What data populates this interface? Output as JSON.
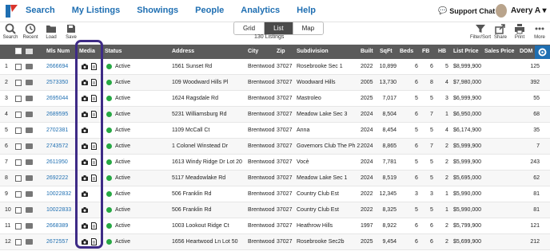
{
  "nav": {
    "links": [
      "Search",
      "My Listings",
      "Showings",
      "People",
      "Analytics",
      "Help"
    ],
    "support": "Support Chat",
    "user": "Avery A"
  },
  "toolbar": {
    "left": [
      "Search",
      "Recent",
      "Load",
      "Save"
    ],
    "views": [
      "Grid",
      "List",
      "Map"
    ],
    "active_view": "List",
    "count": "130 Listings",
    "right": [
      "Filter/Sort",
      "Share",
      "Print",
      "More"
    ]
  },
  "colors": {
    "link": "#1f6fb2",
    "header": "#5b5b5b",
    "active": "#27a844",
    "highlight": "#3e2b86"
  },
  "columns": [
    "Mls Num",
    "Media",
    "Status",
    "Address",
    "City",
    "Zip",
    "Subdivision",
    "Built",
    "SqFt",
    "Beds",
    "FB",
    "HB",
    "List Price",
    "Sales Price",
    "DOM"
  ],
  "rows": [
    {
      "n": "1",
      "mls": "2666694",
      "doc": true,
      "status": "Active",
      "address": "1561 Sunset Rd",
      "city": "Brentwood",
      "zip": "37027",
      "sub": "Rosebrooke Sec 1",
      "built": "2022",
      "sqft": "10,899",
      "beds": "6",
      "fb": "6",
      "hb": "5",
      "price": "$8,999,900",
      "dom": "125"
    },
    {
      "n": "2",
      "mls": "2573350",
      "doc": true,
      "status": "Active",
      "address": "109 Woodward Hills Pl",
      "city": "Brentwood",
      "zip": "37027",
      "sub": "Woodward Hills",
      "built": "2005",
      "sqft": "13,730",
      "beds": "6",
      "fb": "8",
      "hb": "4",
      "price": "$7,980,000",
      "dom": "392"
    },
    {
      "n": "3",
      "mls": "2695044",
      "doc": true,
      "status": "Active",
      "address": "1624 Ragsdale Rd",
      "city": "Brentwood",
      "zip": "37027",
      "sub": "Mastroleo",
      "built": "2025",
      "sqft": "7,017",
      "beds": "5",
      "fb": "5",
      "hb": "3",
      "price": "$6,999,900",
      "dom": "55"
    },
    {
      "n": "4",
      "mls": "2689595",
      "doc": true,
      "status": "Active",
      "address": "5231 Williamsburg Rd",
      "city": "Brentwood",
      "zip": "37027",
      "sub": "Meadow Lake Sec 3",
      "built": "2024",
      "sqft": "8,504",
      "beds": "6",
      "fb": "7",
      "hb": "1",
      "price": "$6,950,000",
      "dom": "68"
    },
    {
      "n": "5",
      "mls": "2702381",
      "doc": false,
      "status": "Active",
      "address": "1109 McCall Ct",
      "city": "Brentwood",
      "zip": "37027",
      "sub": "Anna",
      "built": "2024",
      "sqft": "8,454",
      "beds": "5",
      "fb": "5",
      "hb": "4",
      "price": "$6,174,900",
      "dom": "35"
    },
    {
      "n": "6",
      "mls": "2743572",
      "doc": true,
      "status": "Active",
      "address": "1 Colonel Winstead Dr",
      "city": "Brentwood",
      "zip": "37027",
      "sub": "Governors Club The Ph 2",
      "built": "2024",
      "sqft": "8,865",
      "beds": "6",
      "fb": "7",
      "hb": "2",
      "price": "$5,999,900",
      "dom": "7"
    },
    {
      "n": "7",
      "mls": "2611950",
      "doc": true,
      "status": "Active",
      "address": "1613 Windy Ridge Dr Lot 20",
      "city": "Brentwood",
      "zip": "37027",
      "sub": "Vocè",
      "built": "2024",
      "sqft": "7,781",
      "beds": "5",
      "fb": "5",
      "hb": "2",
      "price": "$5,999,900",
      "dom": "243"
    },
    {
      "n": "8",
      "mls": "2692222",
      "doc": true,
      "status": "Active",
      "address": "5117 Meadowlake Rd",
      "city": "Brentwood",
      "zip": "37027",
      "sub": "Meadow Lake Sec 1",
      "built": "2024",
      "sqft": "8,519",
      "beds": "6",
      "fb": "5",
      "hb": "2",
      "price": "$5,695,000",
      "dom": "62"
    },
    {
      "n": "9",
      "mls": "10022832",
      "doc": false,
      "status": "Active",
      "address": "506 Franklin Rd",
      "city": "Brentwood",
      "zip": "37027",
      "sub": "Country Club Est",
      "built": "2022",
      "sqft": "12,345",
      "beds": "3",
      "fb": "3",
      "hb": "1",
      "price": "$5,990,000",
      "dom": "81"
    },
    {
      "n": "10",
      "mls": "10022833",
      "doc": false,
      "status": "Active",
      "address": "506 Franklin Rd",
      "city": "Brentwood",
      "zip": "37027",
      "sub": "Country Club Est",
      "built": "2022",
      "sqft": "8,325",
      "beds": "5",
      "fb": "5",
      "hb": "1",
      "price": "$5,990,000",
      "dom": "81"
    },
    {
      "n": "11",
      "mls": "2668389",
      "doc": true,
      "status": "Active",
      "address": "1003 Lookout Ridge Ct",
      "city": "Brentwood",
      "zip": "37027",
      "sub": "Heathrow Hills",
      "built": "1997",
      "sqft": "8,922",
      "beds": "6",
      "fb": "6",
      "hb": "2",
      "price": "$5,799,900",
      "dom": "121"
    },
    {
      "n": "12",
      "mls": "2672557",
      "doc": true,
      "status": "Active",
      "address": "1656 Heartwood Ln Lot 50",
      "city": "Brentwood",
      "zip": "37027",
      "sub": "Rosebrooke Sec2b",
      "built": "2025",
      "sqft": "9,454",
      "beds": "6",
      "fb": "6",
      "hb": "2",
      "price": "$5,699,900",
      "dom": "212"
    }
  ]
}
